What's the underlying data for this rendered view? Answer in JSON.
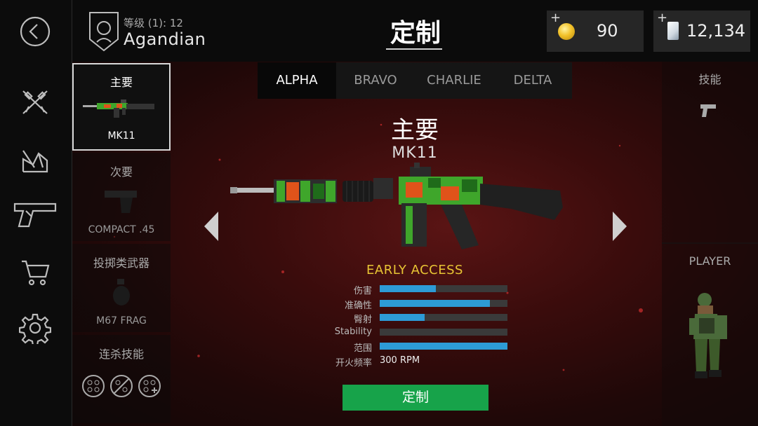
{
  "rail": {
    "items": [
      {
        "icon": "back-arrow-icon"
      },
      {
        "icon": "crossed-rifles-icon"
      },
      {
        "icon": "broken-panel-icon"
      },
      {
        "icon": "pistol-icon"
      },
      {
        "icon": "shopping-cart-icon"
      },
      {
        "icon": "gear-icon"
      }
    ]
  },
  "profile": {
    "level_text": "等级 (1): 12",
    "name": "Agandian"
  },
  "header": {
    "title": "定制"
  },
  "currency": {
    "coins": "90",
    "cards": "12,134",
    "plus": "+"
  },
  "slots": [
    {
      "label": "主要",
      "weapon": "MK11",
      "selected": true
    },
    {
      "label": "次要",
      "weapon": "COMPACT .45",
      "selected": false
    },
    {
      "label": "投掷类武器",
      "weapon": "M67 FRAG",
      "selected": false
    },
    {
      "label": "连杀技能",
      "weapon": "",
      "selected": false
    }
  ],
  "tabs": [
    "ALPHA",
    "BRAVO",
    "CHARLIE",
    "DELTA"
  ],
  "active_tab": "ALPHA",
  "main": {
    "section_title": "主要",
    "weapon_name": "MK11",
    "early_access": "EARLY ACCESS",
    "customize_button": "定制"
  },
  "stats": [
    {
      "label": "伤害",
      "value": 0.44
    },
    {
      "label": "准确性",
      "value": 0.86
    },
    {
      "label": "臀射",
      "value": 0.35
    },
    {
      "label": "Stability",
      "value": 0.0
    },
    {
      "label": "范围",
      "value": 1.0
    }
  ],
  "fire_rate": {
    "label": "开火频率",
    "value": "300 RPM"
  },
  "right_panel": {
    "skills_label": "技能",
    "player_label": "PLAYER"
  },
  "colors": {
    "accent_green": "#17a34a",
    "stat_blue": "#2d9bd6",
    "early_access_yellow": "#e8c534",
    "coin_gold": "#f2c22a"
  }
}
